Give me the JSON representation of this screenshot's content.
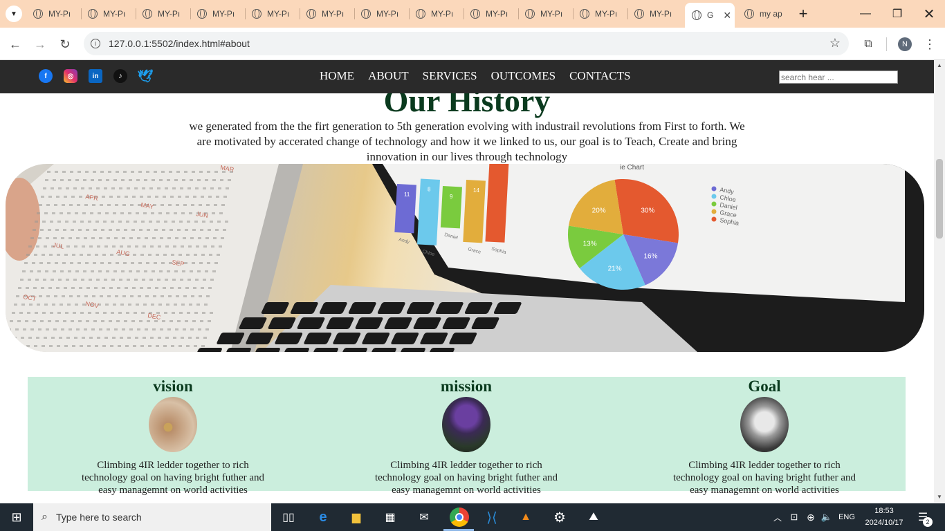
{
  "browser": {
    "tabs": [
      {
        "label": "MY-Pı"
      },
      {
        "label": "MY-Pı"
      },
      {
        "label": "MY-Pı"
      },
      {
        "label": "MY-Pı"
      },
      {
        "label": "MY-Pı"
      },
      {
        "label": "MY-Pı"
      },
      {
        "label": "MY-Pı"
      },
      {
        "label": "MY-Pı"
      },
      {
        "label": "MY-Pı"
      },
      {
        "label": "MY-Pı"
      },
      {
        "label": "MY-Pı"
      },
      {
        "label": "MY-Pı"
      },
      {
        "label": "G"
      },
      {
        "label": "my ap"
      }
    ],
    "url": "127.0.0.1:5502/index.html#about",
    "profile_initial": "N"
  },
  "site": {
    "nav": [
      "HOME",
      "ABOUT",
      "SERVICES",
      "OUTCOMES",
      "CONTACTS"
    ],
    "search_placeholder": "search hear ...",
    "social": [
      "facebook-icon",
      "instagram-icon",
      "linkedin-icon",
      "tiktok-icon",
      "twitter-icon"
    ]
  },
  "history": {
    "title": "Our History",
    "text": "we generated from the the firt generation to 5th generation evolving with industrail revolutions from First to forth. We are motivated by accerated change of technology and how it we linked to us, our goal is to Teach, Create and bring innovation in our lives through technology"
  },
  "hero_chart": {
    "title_fragment": "ie Chart",
    "bars": [
      {
        "label": "Andy",
        "value": "11"
      },
      {
        "label": "Chloe",
        "value": "8"
      },
      {
        "label": "Daniel",
        "value": "9"
      },
      {
        "label": "Grace",
        "value": "14"
      },
      {
        "label": "Sophia",
        "value": ""
      }
    ],
    "pie": [
      "30%",
      "16%",
      "21%",
      "13%",
      "20%"
    ],
    "legend": [
      "Andy",
      "Chloe",
      "Daniel",
      "Grace",
      "Sophia"
    ],
    "calendar_months": [
      "MAR",
      "APR",
      "MAY",
      "JUN",
      "JUL",
      "AUG",
      "SEP",
      "OCT",
      "NOV",
      "DEC"
    ]
  },
  "cards": [
    {
      "title": "vision",
      "text": "Climbing 4IR ledder together to rich technology goal on having bright futher and easy managemnt on world activities"
    },
    {
      "title": "mission",
      "text": "Climbing 4IR ledder together to rich technology goal on having bright futher and easy managemnt on world activities"
    },
    {
      "title": "Goal",
      "text": "Climbing 4IR ledder together to rich technology goal on having bright futher and easy managemnt on world activities"
    }
  ],
  "taskbar": {
    "search_placeholder": "Type here to search",
    "language": "ENG",
    "time": "18:53",
    "date": "2024/10/17",
    "notifications": "2"
  }
}
